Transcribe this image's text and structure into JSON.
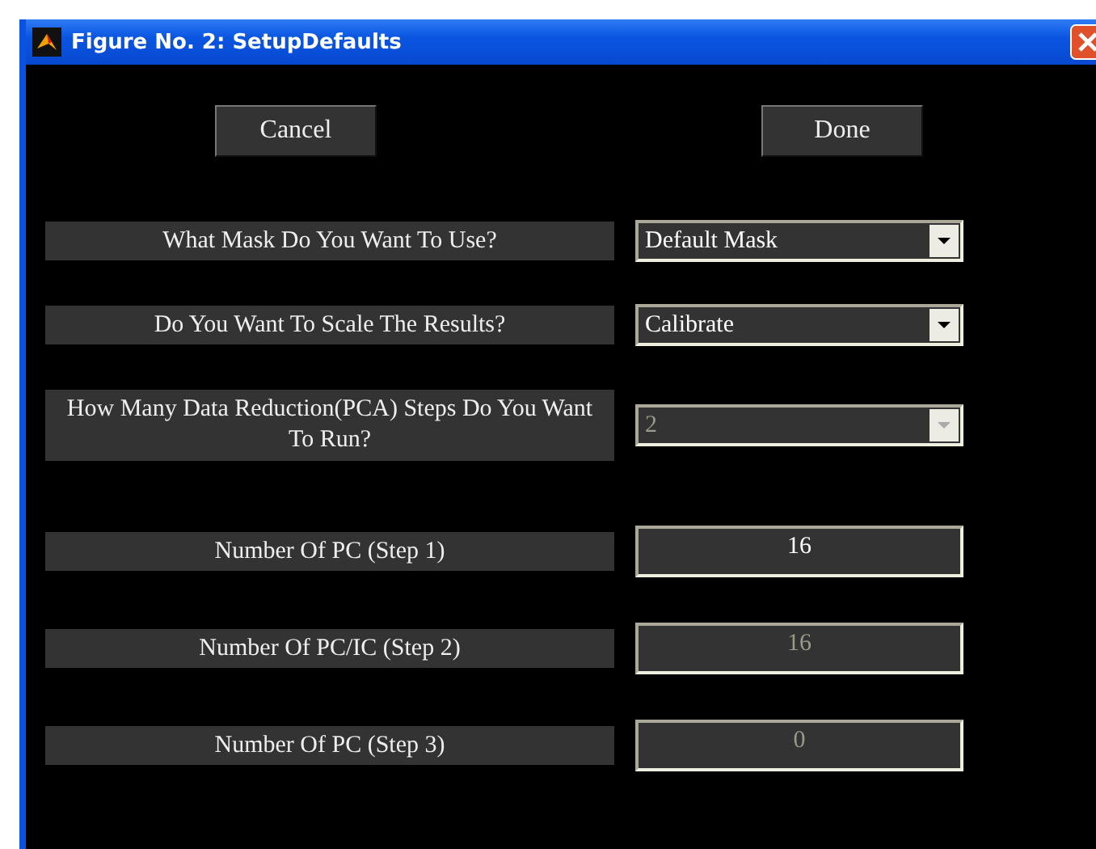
{
  "window": {
    "title": "Figure No.  2: SetupDefaults"
  },
  "buttons": [
    {
      "label": "Cancel"
    },
    {
      "label": "Done"
    }
  ],
  "rows": [
    {
      "kind": "dropdown",
      "label": "What Mask Do You Want To Use?",
      "value": "Default Mask",
      "disabled": false
    },
    {
      "kind": "dropdown",
      "label": "Do You Want To Scale The Results?",
      "value": "Calibrate",
      "disabled": false
    },
    {
      "kind": "dropdown",
      "label": "How Many Data Reduction(PCA) Steps Do You Want To Run?",
      "value": "2",
      "disabled": true
    },
    {
      "kind": "field",
      "label": "Number Of PC (Step 1)",
      "value": "16",
      "disabled": false
    },
    {
      "kind": "field",
      "label": "Number Of PC/IC (Step 2)",
      "value": "16",
      "disabled": true
    },
    {
      "kind": "field",
      "label": "Number Of PC (Step 3)",
      "value": "0",
      "disabled": true
    }
  ]
}
